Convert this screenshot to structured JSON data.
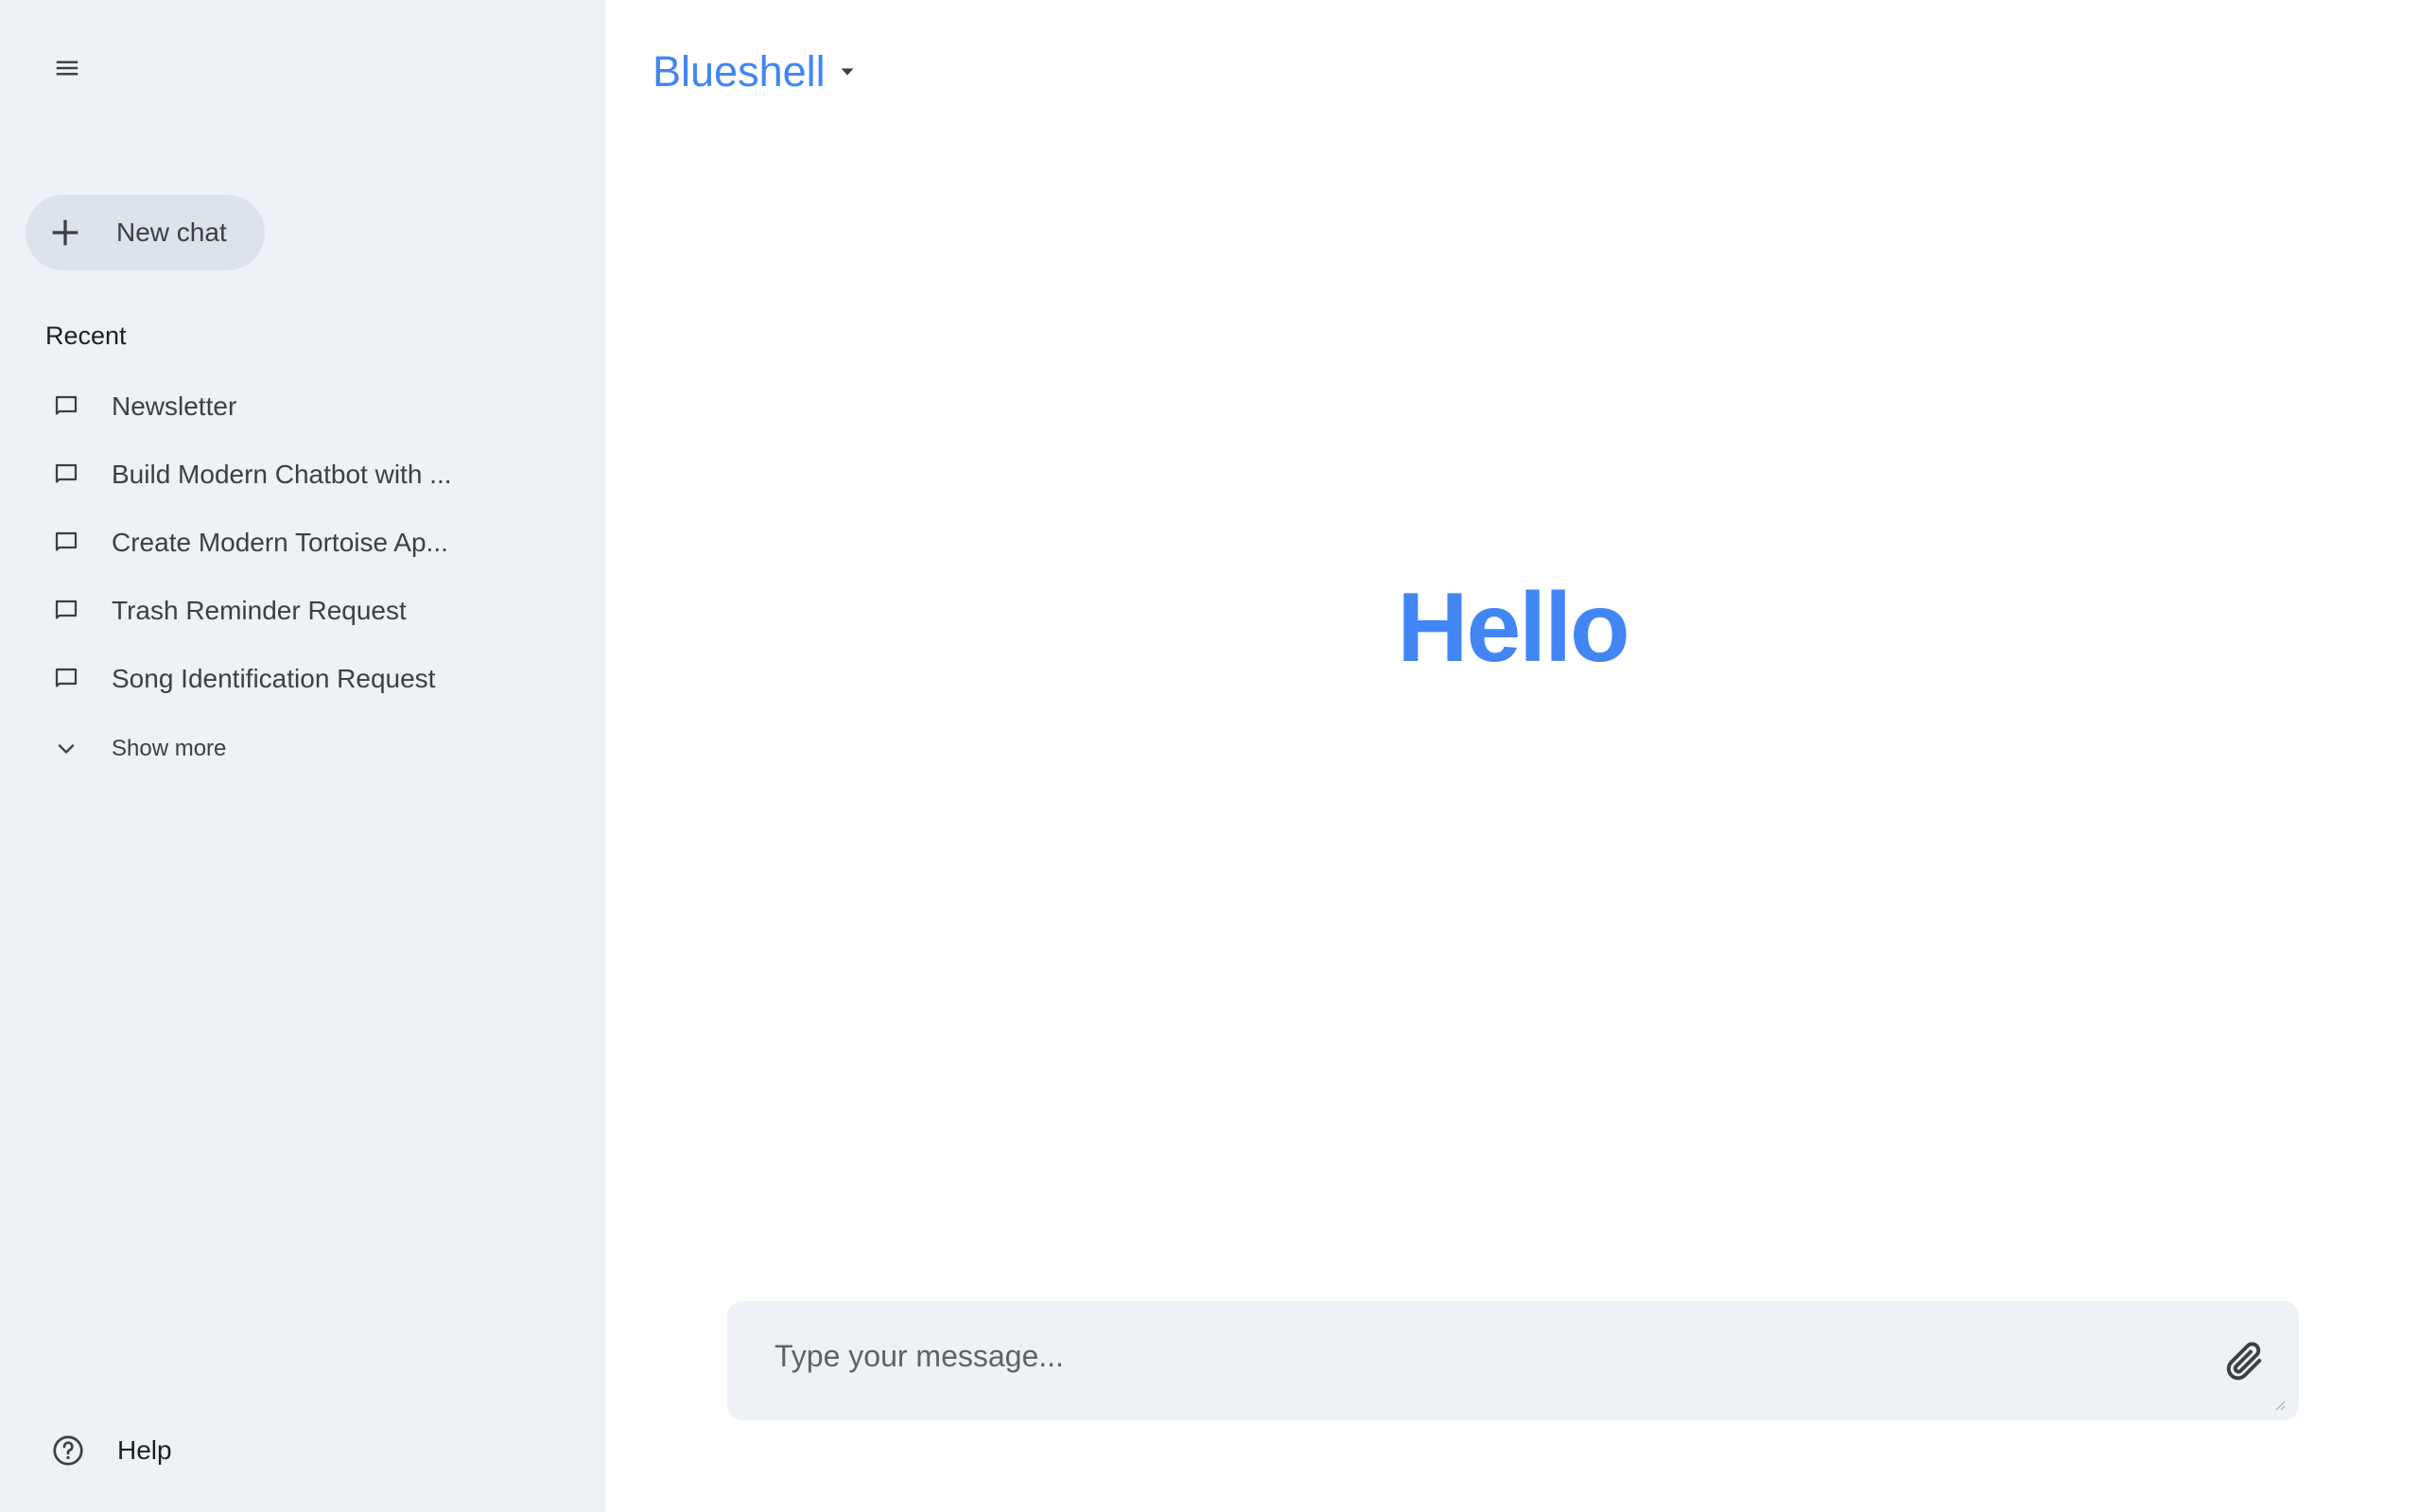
{
  "sidebar": {
    "menu_icon": "hamburger-menu-icon",
    "new_chat": {
      "label": "New chat",
      "icon": "plus-icon"
    },
    "recent_title": "Recent",
    "recent_items": [
      {
        "label": "Newsletter",
        "icon": "chat-bubble-icon"
      },
      {
        "label": "Build Modern Chatbot with ...",
        "icon": "chat-bubble-icon"
      },
      {
        "label": "Create Modern Tortoise Ap...",
        "icon": "chat-bubble-icon"
      },
      {
        "label": "Trash Reminder Request",
        "icon": "chat-bubble-icon"
      },
      {
        "label": "Song Identification Request",
        "icon": "chat-bubble-icon"
      }
    ],
    "show_more": {
      "label": "Show more",
      "icon": "chevron-down-icon"
    },
    "help": {
      "label": "Help",
      "icon": "help-circle-icon"
    }
  },
  "header": {
    "model_name": "Blueshell",
    "caret_icon": "caret-down-icon"
  },
  "main": {
    "greeting": "Hello"
  },
  "composer": {
    "placeholder": "Type your message...",
    "value": "",
    "attach_icon": "paperclip-icon"
  },
  "colors": {
    "accent": "#4285f4",
    "sidebar_bg": "#eef2f7",
    "new_chat_bg": "#dde3ea",
    "composer_bg": "#eef2f7",
    "text": "#1f1f1f",
    "text_secondary": "#3c4043"
  }
}
